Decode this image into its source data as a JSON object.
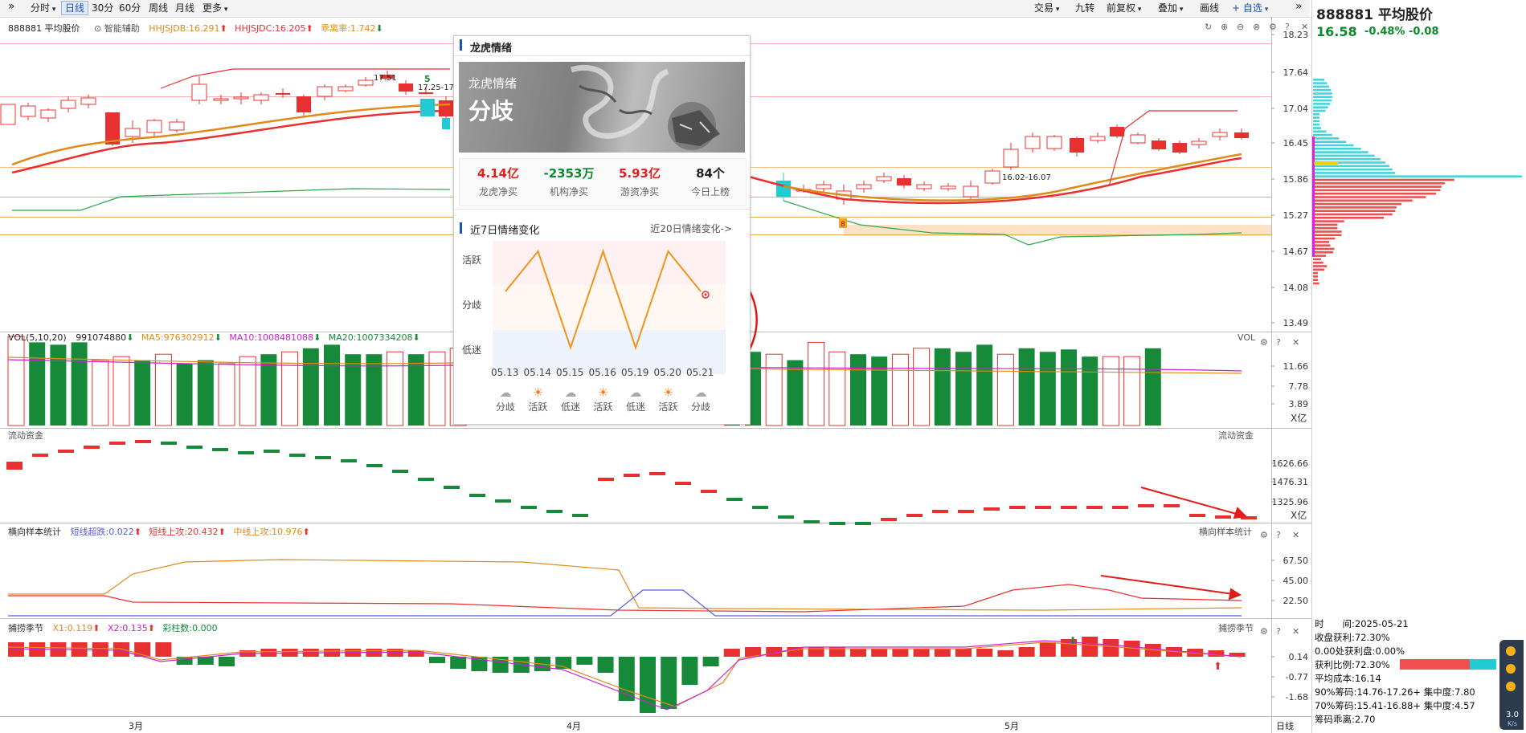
{
  "toolbar": {
    "expand_icon": "double-chevron-right",
    "periods": [
      "分时",
      "日线",
      "30分",
      "60分",
      "周线",
      "月线",
      "更多"
    ],
    "active_period": "日线",
    "right_buttons": [
      "交易",
      "九转",
      "前复权",
      "叠加",
      "画线",
      "+ 自选"
    ],
    "collapse_icon": "double-chevron-right"
  },
  "main_panel": {
    "name": "888881 平均股价",
    "indicator": "智能辅助",
    "hhjsjdb": "HHJSJDB:16.291",
    "hhjsjdc": "HHJSJDC:16.205",
    "deviation": "乖离率:1.742",
    "y_ticks": [
      "18.23",
      "17.64",
      "17.04",
      "16.45",
      "15.86",
      "15.27",
      "14.67",
      "14.08",
      "13.49"
    ],
    "annotations": [
      "17.51",
      "17.25-17",
      "16.02-16.07",
      "5",
      "8"
    ]
  },
  "vol_panel": {
    "title": "VOL(5,10,20)",
    "vol": "991074880",
    "ma5": "MA5:976302912",
    "ma10": "MA10:1008481088",
    "ma20": "MA20:1007334208",
    "label_right": "VOL",
    "y_ticks": [
      "11.66",
      "7.78",
      "3.89"
    ],
    "unit": "X亿"
  },
  "flow_panel": {
    "title": "流动资金",
    "label_right": "流动资金",
    "y_ticks": [
      "1626.66",
      "1476.31",
      "1325.96"
    ],
    "unit": "X亿"
  },
  "stat_panel": {
    "title": "横向样本统计",
    "s1": "短线超跌:0.022",
    "s2": "短线上攻:20.432",
    "s3": "中线上攻:10.976",
    "label_right": "横向样本统计",
    "y_ticks": [
      "67.50",
      "45.00",
      "22.50"
    ]
  },
  "season_panel": {
    "title": "捕捞季节",
    "x1": "X1:0.119",
    "x2": "X2:0.135",
    "bars": "彩柱数:0.000",
    "label_right": "捕捞季节",
    "y_ticks": [
      "0.14",
      "-0.77",
      "-1.68"
    ]
  },
  "x_axis": {
    "months": [
      "3月",
      "4月",
      "5月"
    ],
    "period_label": "日线"
  },
  "popup": {
    "title": "龙虎情绪",
    "banner_title": "龙虎情绪",
    "banner_status": "分歧",
    "stats": [
      {
        "value": "4.14亿",
        "label": "龙虎净买",
        "color": "#e02020"
      },
      {
        "value": "-2353万",
        "label": "机构净买",
        "color": "#0a8a2a"
      },
      {
        "value": "5.93亿",
        "label": "游资净买",
        "color": "#e02020"
      },
      {
        "value": "84个",
        "label": "今日上榜",
        "color": "#222222"
      }
    ],
    "trend_title": "近7日情绪变化",
    "trend_link": "近20日情绪变化->",
    "levels": [
      "活跃",
      "分歧",
      "低迷"
    ],
    "dates": [
      "05.13",
      "05.14",
      "05.15",
      "05.16",
      "05.19",
      "05.20",
      "05.21"
    ],
    "moods": [
      "分歧",
      "活跃",
      "低迷",
      "活跃",
      "低迷",
      "活跃",
      "分歧"
    ],
    "mood_icons": [
      "cloud-icon",
      "sun-icon",
      "cloud-icon",
      "sun-icon",
      "cloud-icon",
      "sun-icon",
      "cloud-icon"
    ]
  },
  "right_panel": {
    "code_name": "888881 平均股价",
    "price": "16.58",
    "change": "-0.48% -0.08",
    "lines": [
      "时　　间:2025-05-21",
      "收盘获利:72.30%",
      "0.00处获利盘:0.00%",
      "获利比例:72.30%",
      "平均成本:16.14",
      "90%筹码:14.76-17.26+ 集中度:7.80",
      "70%筹码:15.41-16.88+ 集中度:4.57",
      "筹码乖离:2.70"
    ]
  },
  "widget": {
    "value": "3.0",
    "unit": "K/s"
  },
  "colors": {
    "up": "#e83030",
    "down": "#178a3a",
    "accent_blue": "#1a56b0",
    "ma_orange": "#e08a1a",
    "cyan": "#22cbd3"
  }
}
